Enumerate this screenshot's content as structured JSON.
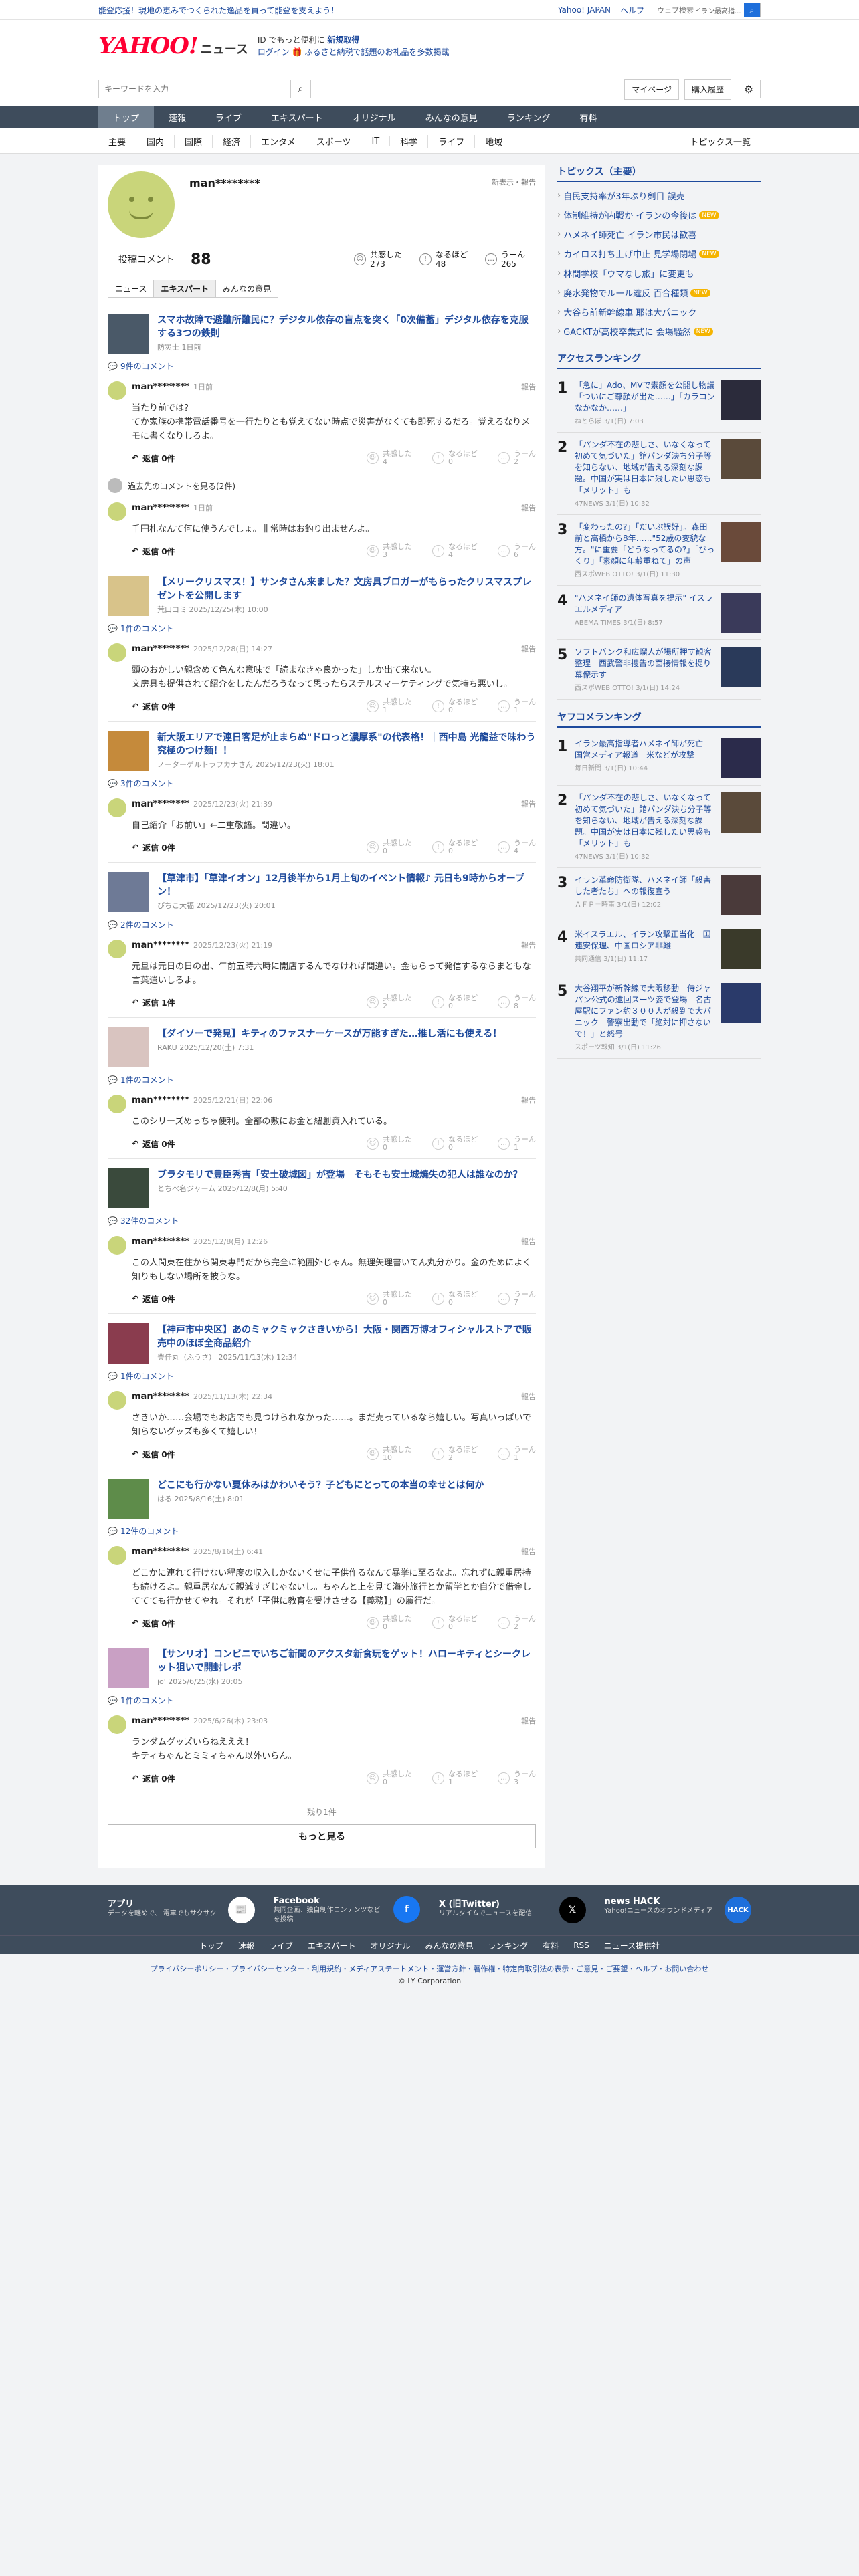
{
  "topbar": {
    "promo": "能登応援！現地の恵みでつくられた逸品を買って能登を支えよう！",
    "links": [
      "Yahoo! JAPAN",
      "ヘルプ"
    ],
    "search_placeholder": "ウェブ検索",
    "search_select": "イラン最高指..."
  },
  "header": {
    "logo": "YAHOO!",
    "logo_sub": "ニュース",
    "msg1": "ID でもっと便利に",
    "msg1b": "新規取得",
    "msg2": "ログイン",
    "msg2b": "🎁 ふるさと納税で話題のお礼品を多数掲載"
  },
  "subheader": {
    "search_placeholder": "キーワードを入力",
    "mypage": "マイページ",
    "history": "購入履歴"
  },
  "nav": [
    "トップ",
    "速報",
    "ライブ",
    "エキスパート",
    "オリジナル",
    "みんなの意見",
    "ランキング",
    "有料"
  ],
  "categories": [
    "主要",
    "国内",
    "国際",
    "経済",
    "エンタメ",
    "スポーツ",
    "IT",
    "科学",
    "ライフ",
    "地域"
  ],
  "categories_right": "トピックス一覧",
  "profile": {
    "name": "man********",
    "notice": "新表示・報告",
    "comment_label": "投稿コメント",
    "comment_count": "88",
    "stats": [
      {
        "label": "共感した",
        "value": "273"
      },
      {
        "label": "なるほど",
        "value": "48"
      },
      {
        "label": "うーん",
        "value": "265"
      }
    ]
  },
  "tabs": [
    "ニュース",
    "エキスパート",
    "みんなの意見"
  ],
  "reply_label": "返信",
  "report_label": "報告",
  "react_labels": [
    "共感した",
    "なるほど",
    "うーん"
  ],
  "entries": [
    {
      "title": "スマホ故障で避難所難民に？デジタル依存の盲点を突く「0次備蓄」デジタル依存を克服する3つの鉄則",
      "source": "防災士 1日前",
      "thumb": "#4a5968",
      "count_label": "9件のコメント",
      "comments": [
        {
          "name": "man********",
          "date": "1日前",
          "text": "当たり前では？\nてか家族の携帯電話番号を一行たりとも覚えてない時点で災害がなくても即死するだろ。覚えるなりメモに書くなりしろよ。",
          "reply": "返信 0件",
          "reacts": [
            "4",
            "0",
            "2"
          ]
        }
      ],
      "older": "過去先のコメントを見る(2件)",
      "comments2": [
        {
          "name": "man********",
          "date": "1日前",
          "text": "千円札なんて何に使うんでしょ。非常時はお釣り出ませんよ。",
          "reply": "返信 0件",
          "reacts": [
            "3",
            "4",
            "6"
          ]
        }
      ]
    },
    {
      "title": "【メリークリスマス！】サンタさん来ました？文房具ブロガーがもらったクリスマスプレゼントを公開します",
      "source": "荒口コミ  2025/12/25(木) 10:00",
      "thumb": "#d8c38a",
      "count_label": "1件のコメント",
      "comments": [
        {
          "name": "man********",
          "date": "2025/12/28(日) 14:27",
          "text": "頭のおかしい親含めて色んな意味で「読まなきゃ良かった」しか出て来ない。\n文房具も提供されて紹介をしたんだろうなって思ったらステルスマーケティングで気持ち悪いし。",
          "reply": "返信 0件",
          "reacts": [
            "1",
            "0",
            "1"
          ]
        }
      ]
    },
    {
      "title": "新大阪エリアで連日客足が止まらぬ\"ドロっと濃厚系\"の代表格！｜西中島 光龍益で味わう究極のつけ麺！！",
      "source": "ノーターゲルトラフカナさん  2025/12/23(火) 18:01",
      "thumb": "#c58a3b",
      "count_label": "3件のコメント",
      "comments": [
        {
          "name": "man********",
          "date": "2025/12/23(火) 21:39",
          "text": "自己紹介「お前い」←二重敬語。間違い。",
          "reply": "返信 0件",
          "reacts": [
            "0",
            "0",
            "4"
          ]
        }
      ]
    },
    {
      "title": "【草津市】「草津イオン」12月後半から1月上旬のイベント情報♪ 元日も9時からオープン！",
      "source": "ぴちこ大福  2025/12/23(火) 20:01",
      "thumb": "#6e7a96",
      "count_label": "2件のコメント",
      "comments": [
        {
          "name": "man********",
          "date": "2025/12/23(火) 21:19",
          "text": "元旦は元日の日の出、午前五時六時に開店するんでなければ間違い。金もらって発信するならまともな言葉遣いしろよ。",
          "reply": "返信 1件",
          "reacts": [
            "2",
            "0",
            "8"
          ]
        }
      ]
    },
    {
      "title": "【ダイソーで発見】キティのファスナーケースが万能すぎた…推し活にも使える！",
      "source": "RAKU  2025/12/20(土) 7:31",
      "thumb": "#d9c4c0",
      "count_label": "1件のコメント",
      "comments": [
        {
          "name": "man********",
          "date": "2025/12/21(日) 22:06",
          "text": "このシリーズめっちゃ便利。全部の敷にお金と紐創資入れている。",
          "reply": "返信 0件",
          "reacts": [
            "0",
            "0",
            "1"
          ]
        }
      ]
    },
    {
      "title": "ブラタモリで豊臣秀吉「安土破城図」が登場　そもそも安土城焼失の犯人は誰なのか？",
      "source": "とちべ名ジャーム  2025/12/8(月) 5:40",
      "thumb": "#3a4a3c",
      "count_label": "32件のコメント",
      "comments": [
        {
          "name": "man********",
          "date": "2025/12/8(月) 12:26",
          "text": "この人間東在住から関東専門だから完全に範囲外じゃん。無理矢理書いてん丸分かり。金のためによく知りもしない場所を披うな。",
          "reply": "返信 0件",
          "reacts": [
            "0",
            "0",
            "7"
          ]
        }
      ]
    },
    {
      "title": "【神戸市中央区】あのミャクミャクさきいから！大阪・関西万博オフィシャルストアで販売中のほぼ全商品紹介",
      "source": "豊佳丸（ふうさ）  2025/11/13(木) 12:34",
      "thumb": "#8a3c4e",
      "count_label": "1件のコメント",
      "comments": [
        {
          "name": "man********",
          "date": "2025/11/13(木) 22:34",
          "text": "さきいか……会場でもお店でも見つけられなかった……。まだ売っているなら嬉しい。写真いっぱいで知らないグッズも多くて嬉しい！",
          "reply": "返信 0件",
          "reacts": [
            "10",
            "2",
            "1"
          ]
        }
      ]
    },
    {
      "title": "どこにも行かない夏休みはかわいそう？子どもにとっての本当の幸せとは何か",
      "source": "はる  2025/8/16(土) 8:01",
      "thumb": "#5e8c4a",
      "count_label": "12件のコメント",
      "comments": [
        {
          "name": "man********",
          "date": "2025/8/16(土) 6:41",
          "text": "どこかに連れて行けない程度の収入しかないくせに子供作るなんて暴挙に至るなよ。忘れずに親重居持ち続けるよ。親重居なんて親減すぎじゃないし。ちゃんと上を見て海外旅行とか留学とか自分で借金しててても行かせてやれ。それが「子供に教育を受けさせる【義務】」の履行だ。",
          "reply": "返信 0件",
          "reacts": [
            "0",
            "0",
            "2"
          ]
        }
      ]
    },
    {
      "title": "【サンリオ】コンビニでいちご新聞のアクスタ新食玩をゲット！ハローキティとシークレット狙いで開封レポ",
      "source": "jo'  2025/6/25(水) 20:05",
      "thumb": "#c9a0c4",
      "count_label": "1件のコメント",
      "comments": [
        {
          "name": "man********",
          "date": "2025/6/26(木) 23:03",
          "text": "ランダムグッズいらねえええ！\nキティちゃんとミミィちゃん以外いらん。",
          "reply": "返信 0件",
          "reacts": [
            "0",
            "1",
            "3"
          ]
        }
      ]
    }
  ],
  "more": {
    "remain": "残り1件",
    "button": "もっと見る"
  },
  "side": {
    "topics_title": "トピックス（主要）",
    "topics": [
      {
        "t": "自民支持率が3年ぶり剣目 誤売",
        "n": false
      },
      {
        "t": "体制維持が内戦か イランの今後は",
        "n": true
      },
      {
        "t": "ハメネイ師死亡 イラン市民は歓喜",
        "n": false
      },
      {
        "t": "カイロス打ち上げ中止 見学場閉場",
        "n": true
      },
      {
        "t": "林間学校「ウマなし旅」に変更も",
        "n": false
      },
      {
        "t": "廃水発物でルール違反 百合種類",
        "n": true
      },
      {
        "t": "大谷ら前新幹線車 耶は大パニック",
        "n": false
      },
      {
        "t": "GACKTが高校卒業式に 会場騒然",
        "n": true
      }
    ],
    "access_title": "アクセスランキング",
    "access": [
      {
        "t": "「急に」Ado、MVで素顔を公開し物議「ついにご尊顔が出た……」「カラコンなかなか……」",
        "s": "ねとらぼ  3/1(日) 7:03",
        "c": "#2b2b3b"
      },
      {
        "t": "「パンダ不在の悲しさ、いなくなって初めて気づいた」館パンダ決ち分子等を知らない、地域が告える深刻な課題。中国が実は日本に残したい思惑も「メリット」も",
        "s": "47NEWS  3/1(日) 10:32",
        "c": "#5a4a3a"
      },
      {
        "t": "「変わったの?」「だいぶ誤好」。森田前と高橋から8年……\"52歳の変貌な方。\"に重要「どうなってるの?」「びっくり」「素顔に年齢重ねて」の声",
        "s": "西スポWEB OTTO!  3/1(日) 11:30",
        "c": "#6a4a3a"
      },
      {
        "t": "\"ハメネイ師の遺体写真を提示\" イスラエルメディア",
        "s": "ABEMA TIMES  3/1(日) 8:57",
        "c": "#3a3a5a"
      },
      {
        "t": "ソフトバンク和広瑠人が場所押す観客整理　西武警非捜告の面接情報を提り幕僚示す",
        "s": "西スポWEB OTTO!  3/1(日) 14:24",
        "c": "#2a3a5a"
      }
    ],
    "yako_title": "ヤフコメランキング",
    "yako": [
      {
        "t": "イラン最高指導者ハメネイ師が死亡　国営メディア報道　米などが攻撃",
        "s": "毎日新聞  3/1(日) 10:44",
        "c": "#2b2b4b"
      },
      {
        "t": "「パンダ不在の悲しさ、いなくなって初めて気づいた」館パンダ決ち分子等を知らない、地域が告える深刻な課題。中国が実は日本に残したい思惑も「メリット」も",
        "s": "47NEWS  3/1(日) 10:32",
        "c": "#5a4a3a"
      },
      {
        "t": "イラン革命防衛隊、ハメネイ師「殺害した者たち」への報復宣う",
        "s": "ＡＦＰ＝時事  3/1(日) 12:02",
        "c": "#4a3a3a"
      },
      {
        "t": "米イスラエル、イラン攻撃正当化　国連安保理、中国ロシア非難",
        "s": "共同通信  3/1(日) 11:17",
        "c": "#3a3a2a"
      },
      {
        "t": "大谷翔平が新幹線で大阪移動　侍ジャパン公式の遠回スーツ姿で登場　名古屋駅にファン約３００人が殺到で大パニック　警察出動で「絶対に押さないで！」と怒号",
        "s": "スポーツ報知  3/1(日) 11:26",
        "c": "#2a3a6a"
      }
    ]
  },
  "footer": {
    "cols": [
      {
        "t": "アプリ",
        "d": "データを軽めで、 電車でもサクサク",
        "i": "📰",
        "c": "#fff",
        "fc": "#1e4a9c"
      },
      {
        "t": "Facebook",
        "d": "共同企画、独自制作コンテンツなどを投稿",
        "i": "f",
        "c": "#1877f2",
        "fc": "#fff"
      },
      {
        "t": "X (旧Twitter)",
        "d": "リアルタイムでニュースを配信",
        "i": "𝕏",
        "c": "#000",
        "fc": "#fff"
      },
      {
        "t": "news HACK",
        "d": "Yahoo!ニュースのオウンドメディア",
        "i": "HACK",
        "c": "#1e6fdb",
        "fc": "#fff"
      }
    ],
    "nav": [
      "トップ",
      "速報",
      "ライブ",
      "エキスパート",
      "オリジナル",
      "みんなの意見",
      "ランキング",
      "有料",
      "RSS",
      "ニュース提供社"
    ],
    "legal": "プライバシーポリシー・プライバシーセンター・利用規約・メディアステートメント・運営方針・著作権・特定商取引法の表示・ご意見・ご要望・ヘルプ・お問い合わせ",
    "copy": "© LY Corporation"
  }
}
